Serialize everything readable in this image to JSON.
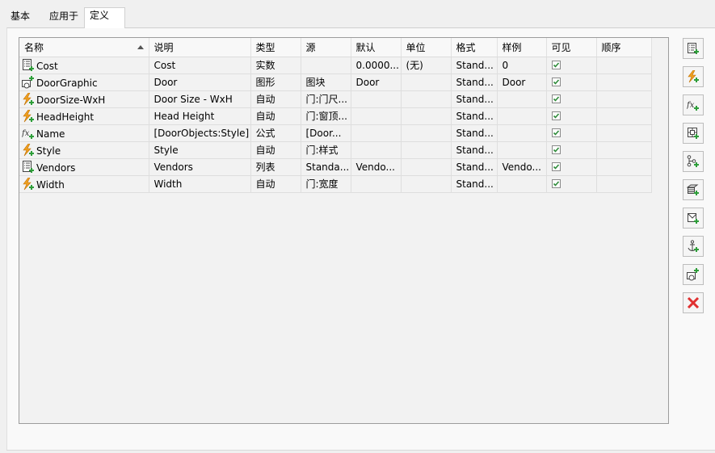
{
  "tabs": [
    {
      "label": "基本",
      "active": false
    },
    {
      "label": "应用于",
      "active": false
    },
    {
      "label": "定义",
      "active": true
    }
  ],
  "columns": [
    "名称",
    "说明",
    "类型",
    "源",
    "默认",
    "单位",
    "格式",
    "样例",
    "可见",
    "顺序"
  ],
  "rows": [
    {
      "icon": "list-definition-icon",
      "name": "Cost",
      "desc": "Cost",
      "type": "实数",
      "source": "",
      "default": "0.0000...",
      "unit": "(无)",
      "format": "Stand...",
      "example": "0",
      "visible": true,
      "order": ""
    },
    {
      "icon": "graphic-definition-icon",
      "name": "DoorGraphic",
      "desc": "Door",
      "type": "图形",
      "source": "图块",
      "default": "Door",
      "unit": "",
      "format": "Stand...",
      "example": "Door",
      "visible": true,
      "order": ""
    },
    {
      "icon": "auto-definition-icon",
      "name": "DoorSize-WxH",
      "desc": "Door Size - WxH",
      "type": "自动",
      "source": "门:门尺...",
      "default": "",
      "unit": "",
      "format": "Stand...",
      "example": "",
      "visible": true,
      "order": ""
    },
    {
      "icon": "auto-definition-icon",
      "name": "HeadHeight",
      "desc": "Head Height",
      "type": "自动",
      "source": "门:窗顶...",
      "default": "",
      "unit": "",
      "format": "Stand...",
      "example": "",
      "visible": true,
      "order": ""
    },
    {
      "icon": "formula-definition-icon",
      "name": "Name",
      "desc": "[DoorObjects:Style]",
      "type": "公式",
      "source": "[Door...",
      "default": "",
      "unit": "",
      "format": "Stand...",
      "example": "",
      "visible": true,
      "order": ""
    },
    {
      "icon": "auto-definition-icon",
      "name": "Style",
      "desc": "Style",
      "type": "自动",
      "source": "门:样式",
      "default": "",
      "unit": "",
      "format": "Stand...",
      "example": "",
      "visible": true,
      "order": ""
    },
    {
      "icon": "list-definition-icon",
      "name": "Vendors",
      "desc": "Vendors",
      "type": "列表",
      "source": "Standa...",
      "default": "Vendo...",
      "unit": "",
      "format": "Stand...",
      "example": "Vendo...",
      "visible": true,
      "order": ""
    },
    {
      "icon": "auto-definition-icon",
      "name": "Width",
      "desc": "Width",
      "type": "自动",
      "source": "门:宽度",
      "default": "",
      "unit": "",
      "format": "Stand...",
      "example": "",
      "visible": true,
      "order": ""
    }
  ],
  "toolbar": [
    {
      "name": "add-manual-property-icon"
    },
    {
      "name": "add-auto-property-icon"
    },
    {
      "name": "add-formula-property-icon"
    },
    {
      "name": "add-location-property-icon"
    },
    {
      "name": "add-classification-property-icon"
    },
    {
      "name": "add-material-property-icon"
    },
    {
      "name": "add-graphic-property-icon"
    },
    {
      "name": "add-anchor-property-icon"
    },
    {
      "name": "add-block-property-icon"
    },
    {
      "name": "delete-property-icon"
    }
  ],
  "colors": {
    "accent_green": "#2e9e3a",
    "bolt_orange": "#f0a020",
    "delete_red": "#e03030"
  }
}
